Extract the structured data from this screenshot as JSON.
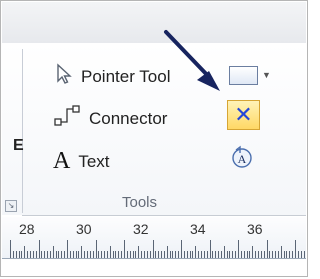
{
  "ribbon": {
    "tools_group": {
      "label": "Tools",
      "pointer_tool_label": "Pointer Tool",
      "connector_label": "Connector",
      "text_label": "Text"
    }
  },
  "ruler": {
    "numbers": [
      "28",
      "30",
      "32",
      "34",
      "36"
    ]
  },
  "colors": {
    "accent_blue": "#2446d8",
    "highlight_yellow": "#ffd865",
    "arrow_navy": "#17245f"
  }
}
